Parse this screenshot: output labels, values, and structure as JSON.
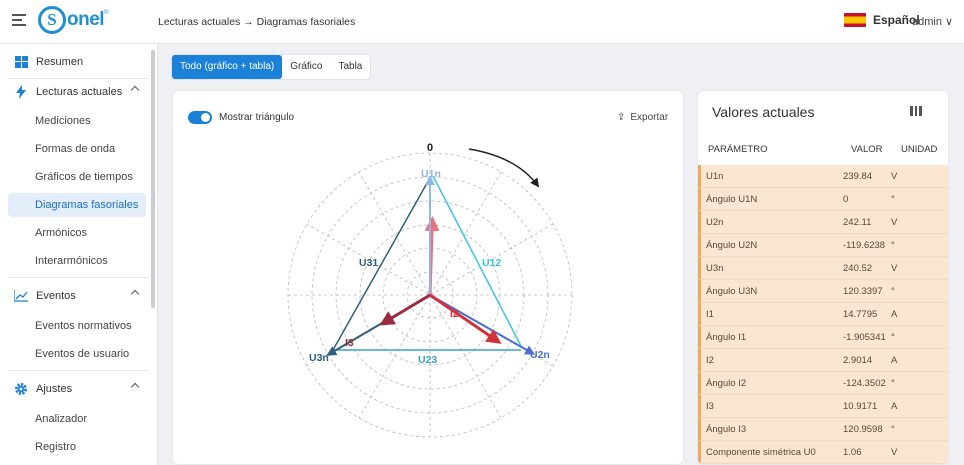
{
  "app": {
    "logo_mark": "S",
    "logo_text": "onel",
    "logo_reg": "®"
  },
  "header": {
    "breadcrumb": "Lecturas actuales → Diagramas fasoriales",
    "language": "Español",
    "user": "admin ∨"
  },
  "sidebar": {
    "resumen": "Resumen",
    "lecturas": "Lecturas actuales",
    "lecturas_items": [
      "Mediciones",
      "Formas de onda",
      "Gráficos de tiempos",
      "Diagramas fasoriales",
      "Armónicos",
      "Interarmónicos"
    ],
    "eventos": "Eventos",
    "eventos_items": [
      "Eventos normativos",
      "Eventos de usuario"
    ],
    "ajustes": "Ajustes",
    "ajustes_items": [
      "Analizador",
      "Registro"
    ]
  },
  "tabs": [
    "Todo (gráfico + tabla)",
    "Gráfico",
    "Tabla"
  ],
  "phasor_card": {
    "toggle_label": "Mostrar triángulo",
    "export_label": "Exportar",
    "zero_label": "0",
    "labels": {
      "U1n": "U1n",
      "U2n": "U2n",
      "U3n": "U3n",
      "U12": "U12",
      "U23": "U23",
      "U31": "U31",
      "I2": "I2",
      "I3": "I3"
    },
    "colors": {
      "u1": "#e8747c",
      "u2": "#4a6fd0",
      "u3": "#2e5f7c",
      "i1": "#e8747c",
      "i2": "#d2313c",
      "i3": "#9b2a3c",
      "u12": "#3ec3e8",
      "u23": "#3a9fc8",
      "u31": "#2e5f7c"
    },
    "vectors": [
      {
        "name": "U1n",
        "magnitude": 239.84,
        "angle": 0
      },
      {
        "name": "U2n",
        "magnitude": 242.11,
        "angle": -119.6238
      },
      {
        "name": "U3n",
        "magnitude": 240.52,
        "angle": 120.3397
      },
      {
        "name": "I1",
        "magnitude": 14.7795,
        "angle": -1.905341
      },
      {
        "name": "I2",
        "magnitude": 2.9014,
        "angle": -124.3502
      },
      {
        "name": "I3",
        "magnitude": 10.9171,
        "angle": 120.9598
      }
    ]
  },
  "values_card": {
    "title": "Valores actuales",
    "headers": {
      "param": "PARÁMETRO",
      "value": "VALOR",
      "unit": "UNIDAD"
    },
    "rows": [
      {
        "param": "U1n",
        "value": "239.84",
        "unit": "V"
      },
      {
        "param": "Ángulo U1N",
        "value": "0",
        "unit": "°"
      },
      {
        "param": "U2n",
        "value": "242.11",
        "unit": "V"
      },
      {
        "param": "Ángulo U2N",
        "value": "-119.6238",
        "unit": "°"
      },
      {
        "param": "U3n",
        "value": "240.52",
        "unit": "V"
      },
      {
        "param": "Ángulo U3N",
        "value": "120.3397",
        "unit": "°"
      },
      {
        "param": "I1",
        "value": "14.7795",
        "unit": "A"
      },
      {
        "param": "Ángulo I1",
        "value": "-1.905341",
        "unit": "°"
      },
      {
        "param": "I2",
        "value": "2.9014",
        "unit": "A"
      },
      {
        "param": "Ángulo I2",
        "value": "-124.3502",
        "unit": "°"
      },
      {
        "param": "I3",
        "value": "10.9171",
        "unit": "A"
      },
      {
        "param": "Ángulo I3",
        "value": "120.9598",
        "unit": "°"
      },
      {
        "param": "Componente simétrica U0",
        "value": "1.06",
        "unit": "V"
      }
    ]
  }
}
